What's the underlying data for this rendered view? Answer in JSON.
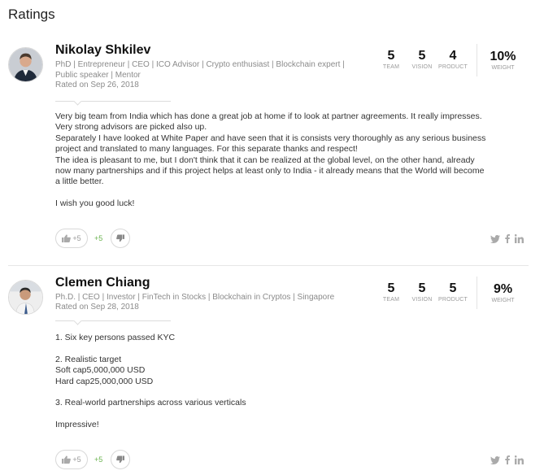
{
  "page": {
    "title": "Ratings"
  },
  "score_labels": {
    "team": "TEAM",
    "vision": "VISION",
    "product": "PRODUCT",
    "weight": "WEIGHT"
  },
  "reviews": [
    {
      "name": "Nikolay Shkilev",
      "titles": "PhD | Entrepreneur | CEO | ICO Advisor | Crypto enthusiast | Blockchain expert | Public speaker | Mentor",
      "rated": "Rated on Sep 26, 2018",
      "scores": {
        "team": "5",
        "vision": "5",
        "product": "4",
        "weight": "10%"
      },
      "lines": [
        "Very big team from India which has done a great job at home if to look at partner agreements. It really impresses.",
        "Very strong advisors are picked also up.",
        "Separately I have looked at White Paper and have seen that it is consists very thoroughly as any serious business",
        "project and translated to many languages. For this separate thanks and respect!",
        "The idea is pleasant to me, but I don't think that it can be realized at the global level, on the other hand, already",
        "now many partnerships and if this project helps at least only to India - it already means that the World will become",
        "a little better.",
        "",
        "I wish you good luck!"
      ],
      "likes": "+5",
      "net": "+5"
    },
    {
      "name": "Clemen Chiang",
      "titles": "Ph.D. | CEO | Investor | FinTech in Stocks | Blockchain in Cryptos | Singapore",
      "rated": "Rated on Sep 28, 2018",
      "scores": {
        "team": "5",
        "vision": "5",
        "product": "5",
        "weight": "9%"
      },
      "lines": [
        "1. Six key persons passed KYC",
        "",
        "2. Realistic target",
        "Soft cap5,000,000 USD",
        "Hard cap25,000,000 USD",
        "",
        "3. Real-world partnerships across various verticals",
        "",
        "Impressive!"
      ],
      "likes": "+5",
      "net": "+5"
    }
  ],
  "icons": {
    "like": "thumbs-up-icon",
    "dislike": "thumbs-down-icon",
    "twitter": "twitter-icon",
    "facebook": "facebook-icon",
    "linkedin": "linkedin-icon"
  },
  "colors": {
    "net_positive": "#6bb34f",
    "muted": "#8b8b8b"
  }
}
